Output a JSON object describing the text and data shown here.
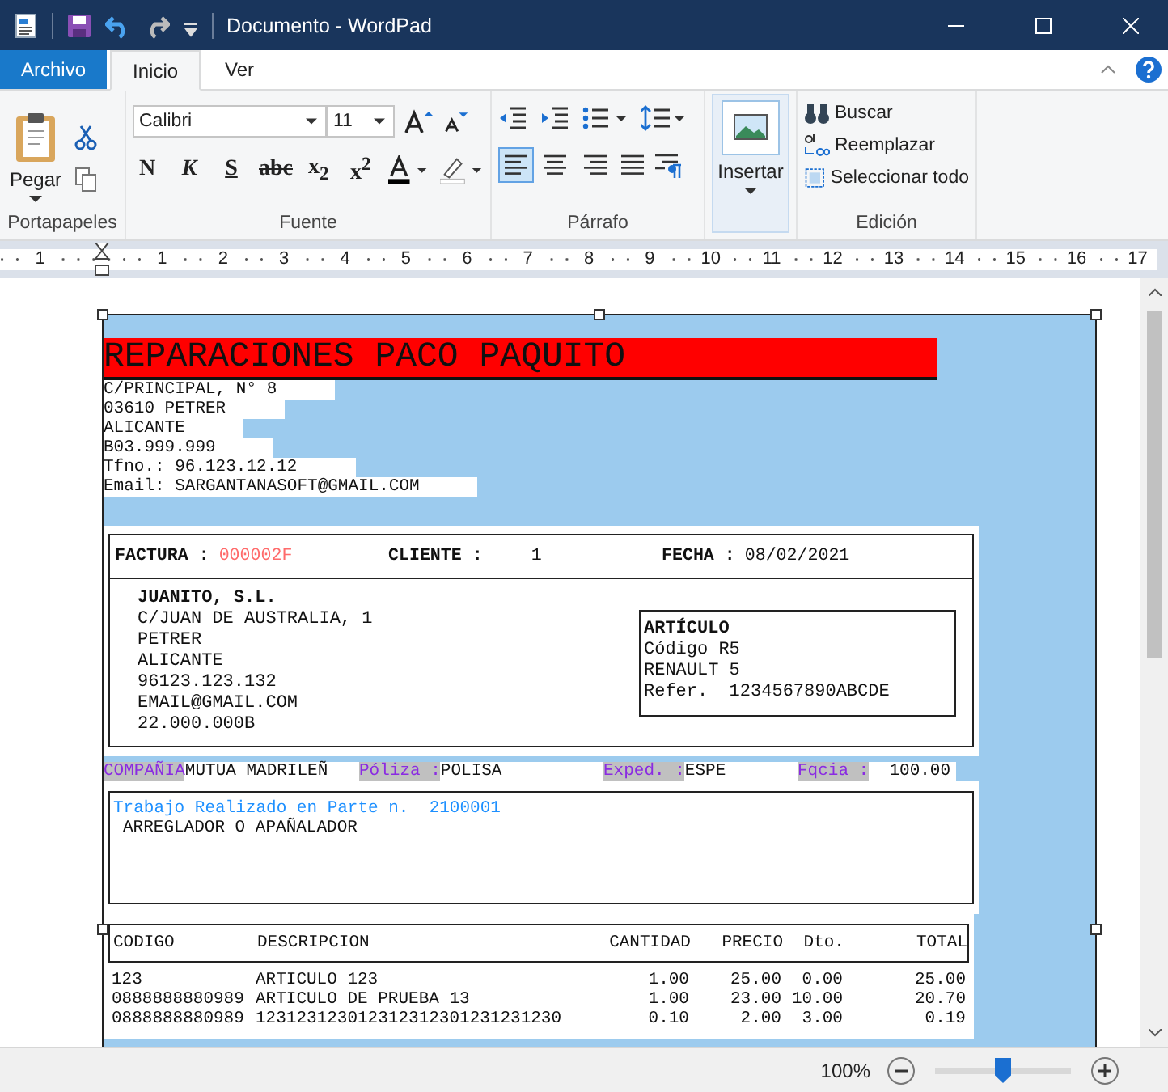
{
  "title_bar": {
    "title": "Documento - WordPad"
  },
  "tabs": [
    {
      "label": "Archivo",
      "kind": "file",
      "selected": false
    },
    {
      "label": "Inicio",
      "kind": "tab",
      "selected": true
    },
    {
      "label": "Ver",
      "kind": "tab",
      "selected": false
    }
  ],
  "ribbon": {
    "clipboard": {
      "paste_label": "Pegar",
      "group_label": "Portapapeles"
    },
    "font": {
      "family": "Calibri",
      "size": "11",
      "group_label": "Fuente",
      "format_buttons": [
        {
          "label": "N",
          "kind": "bold"
        },
        {
          "label": "K",
          "kind": "italic"
        },
        {
          "label": "S",
          "kind": "underline"
        },
        {
          "label": "abc",
          "kind": "strike"
        },
        {
          "label": "x$_{2}$",
          "kind": "plain"
        },
        {
          "label": "x$^{2}$",
          "kind": "plain"
        }
      ]
    },
    "paragraph": {
      "group_label": "Párrafo",
      "alignments": [
        {
          "kind": "left",
          "selected": true
        },
        {
          "kind": "center",
          "selected": false
        },
        {
          "kind": "right",
          "selected": false
        },
        {
          "kind": "justify",
          "selected": false
        }
      ]
    },
    "insert": {
      "label": "Insertar"
    },
    "editing": {
      "group_label": "Edición",
      "items": [
        {
          "label": "Buscar",
          "kind": "find"
        },
        {
          "label": "Reemplazar",
          "kind": "replace"
        },
        {
          "label": "Seleccionar todo",
          "kind": "select"
        }
      ]
    }
  },
  "ruler": {
    "left_label": "1",
    "labels": [
      "1",
      "2",
      "3",
      "4",
      "5",
      "6",
      "7",
      "8",
      "9",
      "10",
      "11",
      "12",
      "13",
      "14",
      "15",
      "16",
      "17"
    ]
  },
  "document": {
    "company": {
      "name": "REPARACIONES PACO PAQUITO",
      "lines": [
        "C/PRINCIPAL, N° 8",
        "03610 PETRER",
        "ALICANTE",
        "B03.999.999",
        "Tfno.: 96.123.12.12",
        "Email: SARGANTANASOFT@GMAIL.COM"
      ]
    },
    "invoice": {
      "fields": [
        {
          "label": "FACTURA :",
          "value": "000002F",
          "kind": "highlight"
        },
        {
          "label": "CLIENTE :",
          "value": "1",
          "kind": "plain"
        },
        {
          "label": "FECHA :",
          "value": "08/02/2021",
          "kind": "plain"
        }
      ],
      "client": {
        "name": "JUANITO, S.L.",
        "lines": [
          "C/JUAN DE AUSTRALIA, 1",
          "PETRER",
          "ALICANTE",
          "96123.123.132",
          "EMAIL@GMAIL.COM",
          "22.000.000B"
        ]
      },
      "article": {
        "title": "ARTÍCULO",
        "lines": [
          "Código R5",
          "RENAULT 5",
          "Refer.  1234567890ABCDE"
        ]
      }
    },
    "policy": [
      {
        "label": "COMPAÑIA",
        "value": "MUTUA MADRILEÑ"
      },
      {
        "label": "Póliza :",
        "value": "POLISA"
      },
      {
        "label": "Exped. :",
        "value": "ESPE"
      },
      {
        "label": "Fqcia :",
        "value": "  100.00"
      }
    ],
    "work": {
      "heading": "Trabajo Realizado en Parte n.  2100001",
      "text": "ARREGLADOR O APAÑALADOR"
    },
    "items": {
      "columns": [
        "CODIGO",
        "DESCRIPCION",
        "CANTIDAD",
        "PRECIO",
        "Dto.",
        "TOTAL"
      ],
      "rows": [
        [
          "123",
          "ARTICULO 123",
          "1.00",
          "25.00",
          "0.00",
          "25.00"
        ],
        [
          "0888888880989",
          "ARTICULO DE PRUEBA 13",
          "1.00",
          "23.00",
          "10.00",
          "20.70"
        ],
        [
          "0888888880989",
          "123123123012312312301231231230",
          "0.10",
          "2.00",
          "3.00",
          "0.19"
        ]
      ]
    }
  },
  "status_bar": {
    "zoom": "100%",
    "level": 0.5
  }
}
